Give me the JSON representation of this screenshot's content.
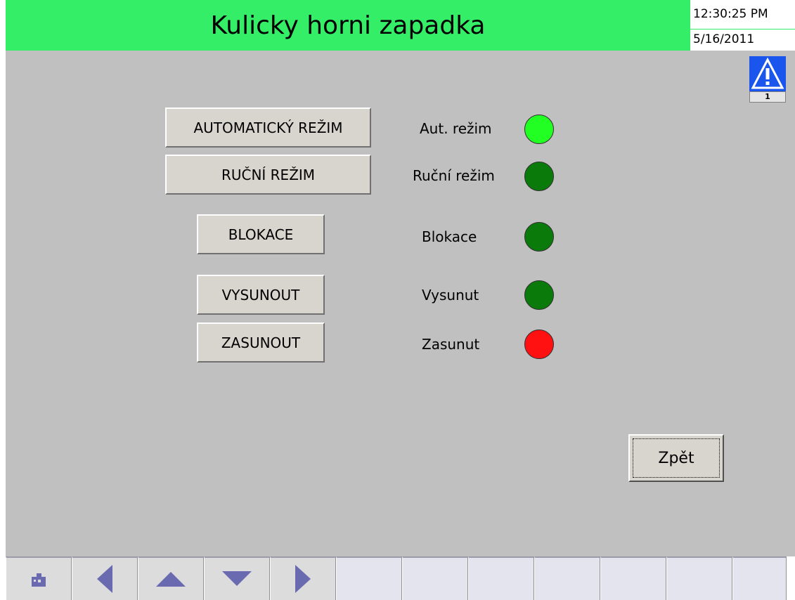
{
  "header": {
    "title": "Kulicky horni zapadka",
    "time": "12:30:25 PM",
    "date": "5/16/2011"
  },
  "alarm": {
    "icon": "warning-icon",
    "count": "1",
    "color": "#1a55ee"
  },
  "controls": [
    {
      "button_label": "AUTOMATICKÝ REŽIM",
      "status_label": "Aut. režim",
      "lamp_state": "on",
      "lamp_color": "#22ff22"
    },
    {
      "button_label": "RUČNÍ REŽIM",
      "status_label": "Ruční režim",
      "lamp_state": "off",
      "lamp_color": "#0a7a0a"
    },
    {
      "button_label": "BLOKACE",
      "status_label": "Blokace",
      "lamp_state": "off",
      "lamp_color": "#0a7a0a"
    },
    {
      "button_label": "VYSUNOUT",
      "status_label": "Vysunut",
      "lamp_state": "off",
      "lamp_color": "#0a7a0a"
    },
    {
      "button_label": "ZASUNOUT",
      "status_label": "Zasunut",
      "lamp_state": "alarm",
      "lamp_color": "#ff1111"
    }
  ],
  "back_button": {
    "label": "Zpět"
  },
  "function_keys": [
    {
      "icon": "home-icon"
    },
    {
      "icon": "arrow-left-icon"
    },
    {
      "icon": "arrow-up-icon"
    },
    {
      "icon": "arrow-down-icon"
    },
    {
      "icon": "arrow-right-icon"
    },
    {
      "icon": ""
    },
    {
      "icon": ""
    },
    {
      "icon": ""
    },
    {
      "icon": ""
    },
    {
      "icon": ""
    },
    {
      "icon": ""
    },
    {
      "icon": ""
    }
  ],
  "colors": {
    "title_bar": "#33ee66",
    "background": "#c0c0c0",
    "nav_icon": "#6a6ab0"
  }
}
